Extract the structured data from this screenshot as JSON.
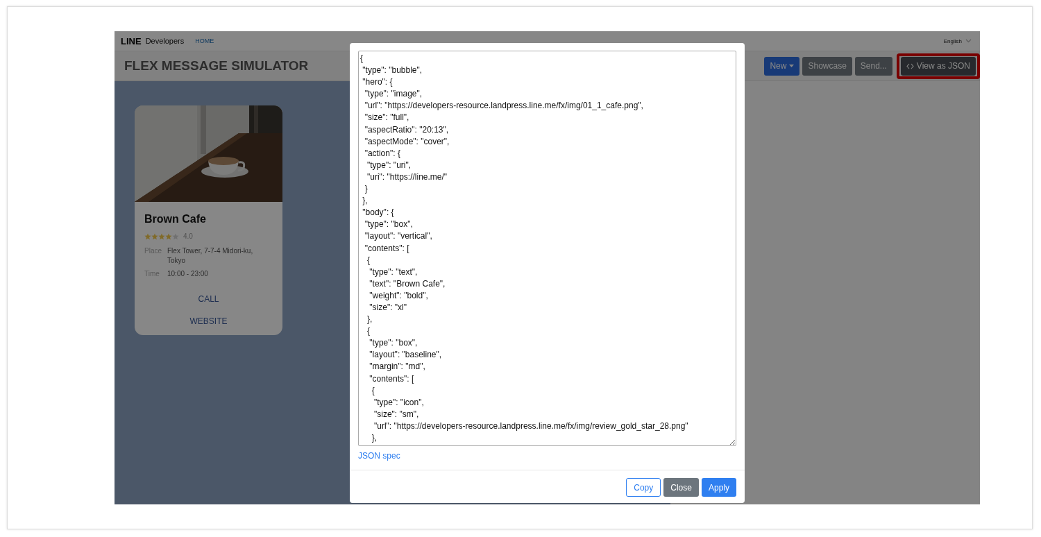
{
  "header": {
    "brand": "LINE",
    "product": "Developers",
    "nav_link": "HOME",
    "language": "English"
  },
  "toolbar": {
    "title": "FLEX MESSAGE SIMULATOR",
    "buttons": [
      {
        "label": "New",
        "kind": "dropdown",
        "highlighted": false
      },
      {
        "label": "Showcase",
        "kind": "plain",
        "highlighted": false
      },
      {
        "label": "Send...",
        "kind": "plain",
        "highlighted": false
      },
      {
        "label": "View as JSON",
        "kind": "code",
        "highlighted": true
      }
    ]
  },
  "preview_card": {
    "hero": {
      "kind": "picture"
    },
    "title": "Brown Cafe",
    "stars": 4,
    "rating": "4.0",
    "details": [
      {
        "label": "Place",
        "value": "Flex Tower, 7-7-4 Midori-ku, Tokyo"
      },
      {
        "label": "Time",
        "value": "10:00 - 23:00"
      }
    ],
    "actions": [
      "CALL",
      "WEBSITE"
    ]
  },
  "dialog": {
    "json_lines": [
      "{",
      " \"type\": \"bubble\",",
      " \"hero\": {",
      "  \"type\": \"image\",",
      "  \"url\": \"https://developers-resource.landpress.line.me/fx/img/01_1_cafe.png\",",
      "  \"size\": \"full\",",
      "  \"aspectRatio\": \"20:13\",",
      "  \"aspectMode\": \"cover\",",
      "  \"action\": {",
      "   \"type\": \"uri\",",
      "   \"uri\": \"https://line.me/\"",
      "  }",
      " },",
      " \"body\": {",
      "  \"type\": \"box\",",
      "  \"layout\": \"vertical\",",
      "  \"contents\": [",
      "   {",
      "    \"type\": \"text\",",
      "    \"text\": \"Brown Cafe\",",
      "    \"weight\": \"bold\",",
      "    \"size\": \"xl\"",
      "   },",
      "   {",
      "    \"type\": \"box\",",
      "    \"layout\": \"baseline\",",
      "    \"margin\": \"md\",",
      "    \"contents\": [",
      "     {",
      "      \"type\": \"icon\",",
      "      \"size\": \"sm\",",
      "      \"url\": \"https://developers-resource.landpress.line.me/fx/img/review_gold_star_28.png\"",
      "     },"
    ],
    "spec_link": "JSON spec",
    "buttons": [
      {
        "label": "Copy",
        "kind": "outline"
      },
      {
        "label": "Close",
        "kind": "secondary"
      },
      {
        "label": "Apply",
        "kind": "primary"
      }
    ]
  }
}
